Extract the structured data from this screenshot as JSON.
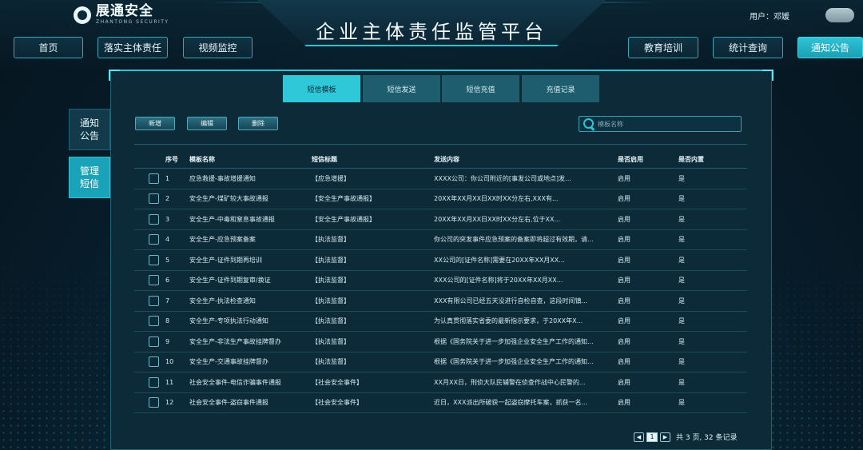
{
  "header": {
    "logo_cn": "展通安全",
    "logo_en": "ZHANTONG SECURITY",
    "title": "企业主体责任监管平台",
    "user": "用户：邓媛"
  },
  "nav": {
    "left": [
      "首页",
      "落实主体责任",
      "视频监控"
    ],
    "right": [
      "教育培训",
      "统计查询",
      "通知公告"
    ],
    "active": "通知公告"
  },
  "side": {
    "items": [
      "通知公告",
      "管理短信"
    ],
    "active": "管理短信"
  },
  "subtabs": {
    "items": [
      "短信模板",
      "短信发送",
      "短信充值",
      "充值记录"
    ],
    "active": "短信模板"
  },
  "toolbar": {
    "add": "新增",
    "edit": "编辑",
    "delete": "删除",
    "search_placeholder": "模板名称"
  },
  "table": {
    "headers": {
      "index": "序号",
      "name": "模板名称",
      "subject": "短信标题",
      "content": "发送内容",
      "enabled": "是否启用",
      "builtin": "是否内置"
    },
    "rows": [
      {
        "index": "1",
        "name": "应急救援-事故增援通知",
        "subject": "【应急增援】",
        "content": "XXXX公司：你公司附近的[事发公司或地点]发...",
        "enabled": "启用",
        "builtin": "是"
      },
      {
        "index": "2",
        "name": "安全生产-煤矿较大事故通报",
        "subject": "【安全生产事故通报】",
        "content": "20XX年XX月XX日XX时XX分左右,XXX有...",
        "enabled": "启用",
        "builtin": "是"
      },
      {
        "index": "3",
        "name": "安全生产-中毒和窒息事故通报",
        "subject": "【安全生产事故通报】",
        "content": "20XX年XX月XX日XX时XX分左右,位于XX...",
        "enabled": "启用",
        "builtin": "是"
      },
      {
        "index": "4",
        "name": "安全生产-应急预案备案",
        "subject": "【执法监督】",
        "content": "你公司的突发事件应急预案的备案即将超过有效期，请...",
        "enabled": "启用",
        "builtin": "是"
      },
      {
        "index": "5",
        "name": "安全生产-证件到期再培训",
        "subject": "【执法监督】",
        "content": "XX公司的[证件名称]需要在20XX年XX月XX...",
        "enabled": "启用",
        "builtin": "是"
      },
      {
        "index": "6",
        "name": "安全生产-证件到期复审/换证",
        "subject": "【执法监督】",
        "content": "XXX公司的[证件名称]将于20XX年XX月XX...",
        "enabled": "启用",
        "builtin": "是"
      },
      {
        "index": "7",
        "name": "安全生产-执法检查通知",
        "subject": "【执法监督】",
        "content": "XXX有限公司已经五天没进行自检自查，这段时间镇...",
        "enabled": "启用",
        "builtin": "是"
      },
      {
        "index": "8",
        "name": "安全生产-专项执法行动通知",
        "subject": "【执法监督】",
        "content": "为认真贯彻落实省委的最新指示要求，于20XX年X...",
        "enabled": "启用",
        "builtin": "是"
      },
      {
        "index": "9",
        "name": "安全生产-非法生产事故挂牌督办",
        "subject": "【执法监督】",
        "content": "根据《国务院关于进一步加强企业安全生产工作的通知...",
        "enabled": "启用",
        "builtin": "是"
      },
      {
        "index": "10",
        "name": "安全生产-交通事故挂牌督办",
        "subject": "【执法监督】",
        "content": "根据《国务院关于进一步加强企业安全生产工作的通知...",
        "enabled": "启用",
        "builtin": "是"
      },
      {
        "index": "11",
        "name": "社会安全事件-电信诈骗事件通报",
        "subject": "【社会安全事件】",
        "content": "XX月XX日，刑侦大队民辅警在侦查作战中心民警的...",
        "enabled": "启用",
        "builtin": "是"
      },
      {
        "index": "12",
        "name": "社会安全事件-盗窃事件通报",
        "subject": "【社会安全事件】",
        "content": "近日，XXX派出所破获一起盗窃摩托车案，抓获一名...",
        "enabled": "启用",
        "builtin": "是"
      }
    ]
  },
  "pager": {
    "prev": "◀",
    "current": "1",
    "next": "▶",
    "summary": "共 3 页, 32 条记录"
  }
}
